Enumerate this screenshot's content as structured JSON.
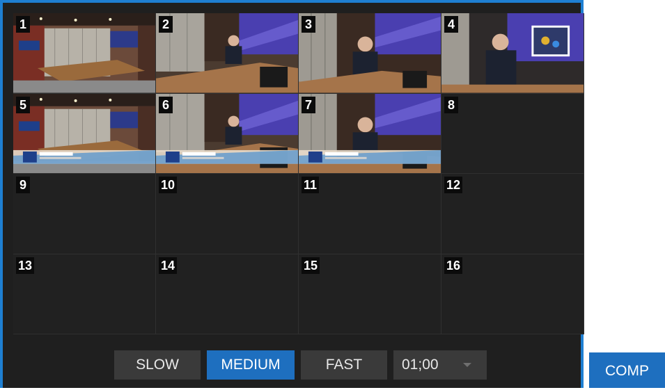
{
  "slots": [
    {
      "number": "1",
      "preview": "conference-room-wide"
    },
    {
      "number": "2",
      "preview": "presenter-table"
    },
    {
      "number": "3",
      "preview": "presenter-closeup"
    },
    {
      "number": "4",
      "preview": "presenter-monitor"
    },
    {
      "number": "5",
      "preview": "conference-room-wide-lowerthird"
    },
    {
      "number": "6",
      "preview": "presenter-table-lowerthird"
    },
    {
      "number": "7",
      "preview": "presenter-closeup-lowerthird"
    },
    {
      "number": "8",
      "preview": "empty"
    },
    {
      "number": "9",
      "preview": "empty"
    },
    {
      "number": "10",
      "preview": "empty"
    },
    {
      "number": "11",
      "preview": "empty"
    },
    {
      "number": "12",
      "preview": "empty"
    },
    {
      "number": "13",
      "preview": "empty"
    },
    {
      "number": "14",
      "preview": "empty"
    },
    {
      "number": "15",
      "preview": "empty"
    },
    {
      "number": "16",
      "preview": "empty"
    }
  ],
  "speed": {
    "slow": "SLOW",
    "medium": "MEDIUM",
    "fast": "FAST",
    "selected": "medium"
  },
  "duration": {
    "value": "01;00",
    "icon": "chevron-down-icon"
  },
  "comp_label": "COMP",
  "colors": {
    "accent": "#1e7fd2",
    "active_button": "#1e6fbf",
    "panel_bg": "#1f1f1f",
    "button_bg": "#3a3a3a"
  }
}
